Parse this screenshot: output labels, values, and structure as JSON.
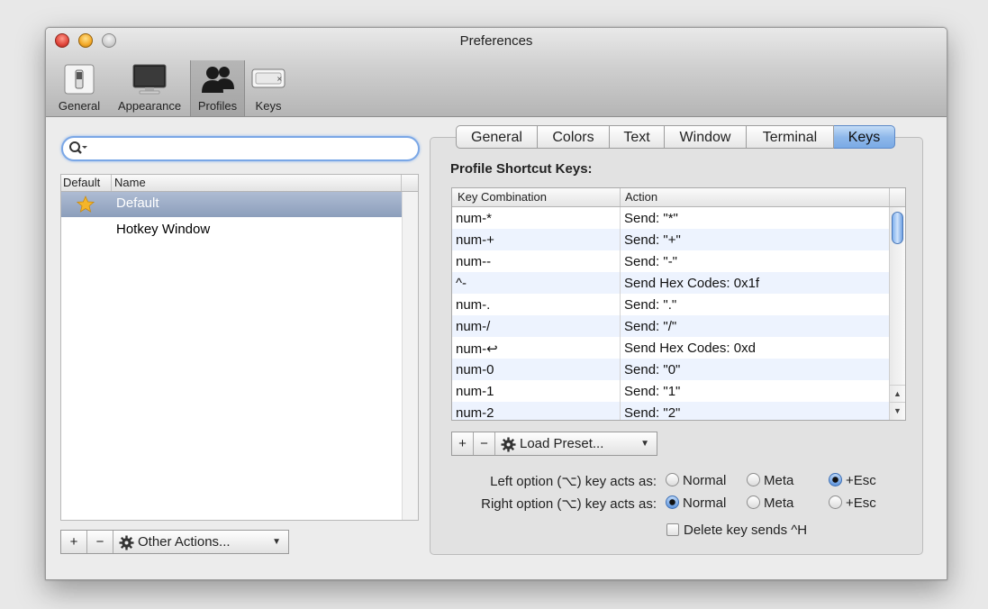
{
  "window": {
    "title": "Preferences"
  },
  "toolbar": {
    "items": [
      {
        "label": "General"
      },
      {
        "label": "Appearance"
      },
      {
        "label": "Profiles"
      },
      {
        "label": "Keys"
      }
    ],
    "selected": "Profiles"
  },
  "profiles": {
    "search": {
      "value": "",
      "placeholder": ""
    },
    "headers": {
      "default": "Default",
      "name": "Name"
    },
    "items": [
      {
        "name": "Default",
        "is_default": true,
        "selected": true
      },
      {
        "name": "Hotkey Window",
        "is_default": false,
        "selected": false
      }
    ],
    "buttons": {
      "add": "+",
      "remove": "−",
      "other_actions": "Other Actions..."
    }
  },
  "profile_tabs": {
    "items": [
      {
        "label": "General"
      },
      {
        "label": "Colors"
      },
      {
        "label": "Text"
      },
      {
        "label": "Window"
      },
      {
        "label": "Terminal"
      },
      {
        "label": "Keys"
      }
    ],
    "active": "Keys"
  },
  "keys_panel": {
    "title": "Profile Shortcut Keys:",
    "table": {
      "headers": {
        "key": "Key Combination",
        "action": "Action"
      },
      "rows": [
        {
          "key": "num-*",
          "action": "Send: \"*\""
        },
        {
          "key": "num-+",
          "action": "Send: \"+\""
        },
        {
          "key": "num--",
          "action": "Send: \"-\""
        },
        {
          "key": "^-",
          "action": "Send Hex Codes: 0x1f"
        },
        {
          "key": "num-.",
          "action": "Send: \".\""
        },
        {
          "key": "num-/",
          "action": "Send: \"/\""
        },
        {
          "key": "num-↩",
          "action": "Send Hex Codes: 0xd"
        },
        {
          "key": "num-0",
          "action": "Send: \"0\""
        },
        {
          "key": "num-1",
          "action": "Send: \"1\""
        },
        {
          "key": "num-2",
          "action": "Send: \"2\""
        }
      ],
      "scroll_up": "▲",
      "scroll_down": "▼"
    },
    "buttons": {
      "add": "+",
      "remove": "−",
      "load_preset": "Load Preset..."
    },
    "left_option": {
      "label": "Left option (⌥) key acts as:",
      "options": [
        "Normal",
        "Meta",
        "+Esc"
      ],
      "selected": "+Esc"
    },
    "right_option": {
      "label": "Right option (⌥) key acts as:",
      "options": [
        "Normal",
        "Meta",
        "+Esc"
      ],
      "selected": "Normal"
    },
    "delete_key": {
      "label": "Delete key sends ^H",
      "checked": false
    }
  },
  "colors": {
    "accent": "#7aaae5",
    "selection": "#8c9ebb",
    "alt_row": "#edf3fe"
  }
}
